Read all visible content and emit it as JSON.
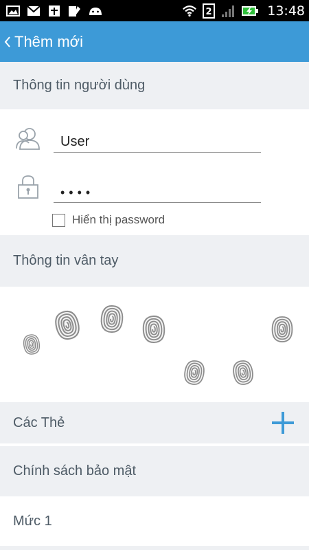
{
  "status_bar": {
    "left_icons": [
      "gallery-icon",
      "gmail-icon",
      "calendar-icon",
      "notes-icon",
      "android-icon"
    ],
    "right_icons": [
      "wifi-icon",
      "sim-2-icon",
      "signal-icon",
      "battery-charging-icon"
    ],
    "sim_label": "2",
    "time": "13:48"
  },
  "app_bar": {
    "back_icon": "chevron-left-icon",
    "title": "Thêm mới",
    "background": "#3d9ad7"
  },
  "user_info": {
    "header": "Thông tin người dùng",
    "username_value": "User",
    "password_value": "••••",
    "show_password_label": "Hiển thị password",
    "show_password_checked": false
  },
  "fingerprint": {
    "header": "Thông tin vân tay",
    "icon": "fingerprint-icon",
    "count": 7
  },
  "cards": {
    "label": "Các Thẻ",
    "add_icon": "plus-icon",
    "accent": "#3d9ad7"
  },
  "security_policy": {
    "header": "Chính sách bảo mật",
    "level": "Mức 1"
  }
}
